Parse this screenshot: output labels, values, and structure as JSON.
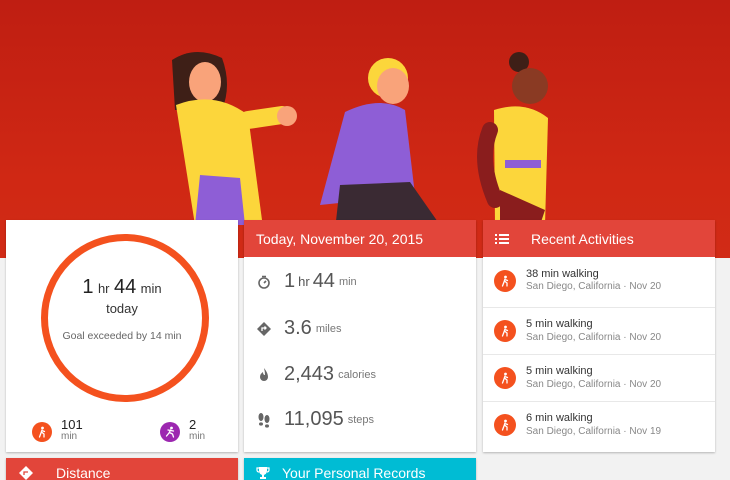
{
  "summary": {
    "hours": "1",
    "hours_unit": "hr",
    "minutes": "44",
    "minutes_unit": "min",
    "period": "today",
    "goal_text": "Goal exceeded by 14 min",
    "walk_minutes": "101",
    "walk_unit": "min",
    "run_minutes": "2",
    "run_unit": "min"
  },
  "daily": {
    "title": "Today, November 20, 2015",
    "duration_hours": "1",
    "duration_hours_unit": "hr",
    "duration_minutes": "44",
    "duration_minutes_unit": "min",
    "distance": "3.6",
    "distance_unit": "miles",
    "calories": "2,443",
    "calories_unit": "calories",
    "steps": "11,095",
    "steps_unit": "steps"
  },
  "recent": {
    "title": "Recent Activities",
    "items": [
      {
        "title": "38 min walking",
        "subtitle": "San Diego, California · Nov 20"
      },
      {
        "title": "5 min walking",
        "subtitle": "San Diego, California · Nov 20"
      },
      {
        "title": "5 min walking",
        "subtitle": "San Diego, California · Nov 20"
      },
      {
        "title": "6 min walking",
        "subtitle": "San Diego, California · Nov 19"
      }
    ]
  },
  "distance_card": {
    "title": "Distance"
  },
  "records_card": {
    "title": "Your Personal Records"
  },
  "colors": {
    "accent": "#f4511e",
    "header_red": "#e2453a",
    "records_cyan": "#00bcd4",
    "run_purple": "#9c27b0"
  }
}
